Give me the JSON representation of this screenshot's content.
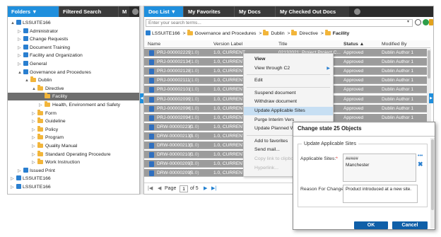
{
  "left_panel": {
    "tabs": [
      {
        "label": "Folders ▼",
        "active": true
      },
      {
        "label": "Filtered Search",
        "active": false
      },
      {
        "label": "M",
        "active": false
      }
    ],
    "tree": [
      {
        "label": "LSSUITE166",
        "icon": "site-icon",
        "toggle": "▲",
        "level": 0
      },
      {
        "label": "Administrator",
        "icon": "site-icon",
        "toggle": "▷",
        "level": 1
      },
      {
        "label": "Change Requests",
        "icon": "site-icon",
        "toggle": "▷",
        "level": 1
      },
      {
        "label": "Document Training",
        "icon": "site-icon",
        "toggle": "▷",
        "level": 1
      },
      {
        "label": "Facility and Organization",
        "icon": "site-icon",
        "toggle": "▷",
        "level": 1
      },
      {
        "label": "General",
        "icon": "site-icon",
        "toggle": "▷",
        "level": 1
      },
      {
        "label": "Governance and Procedures",
        "icon": "site-icon",
        "toggle": "▲",
        "level": 1
      },
      {
        "label": "Dublin",
        "icon": "folder-icon",
        "toggle": "▲",
        "level": 2
      },
      {
        "label": "Directive",
        "icon": "folder-icon",
        "toggle": "▲",
        "level": 3
      },
      {
        "label": "Facility",
        "icon": "folder-icon",
        "toggle": "",
        "level": 4,
        "selected": true
      },
      {
        "label": "Health, Environment and Safety",
        "icon": "folder-icon",
        "toggle": "▷",
        "level": 4
      },
      {
        "label": "Form",
        "icon": "folder-icon",
        "toggle": "▷",
        "level": 3
      },
      {
        "label": "Guideline",
        "icon": "folder-icon",
        "toggle": "▷",
        "level": 3
      },
      {
        "label": "Policy",
        "icon": "folder-icon",
        "toggle": "▷",
        "level": 3
      },
      {
        "label": "Program",
        "icon": "folder-icon",
        "toggle": "▷",
        "level": 3
      },
      {
        "label": "Quality Manual",
        "icon": "folder-icon",
        "toggle": "▷",
        "level": 3
      },
      {
        "label": "Standard Operating Procedure",
        "icon": "folder-icon",
        "toggle": "▷",
        "level": 3
      },
      {
        "label": "Work Instruction",
        "icon": "folder-icon",
        "toggle": "▷",
        "level": 3
      },
      {
        "label": "Issued Print",
        "icon": "site-icon",
        "toggle": "▷",
        "level": 1
      },
      {
        "label": "LSSUITE166",
        "icon": "site-icon",
        "toggle": "▷",
        "level": 0
      },
      {
        "label": "LSSUITE166",
        "icon": "site-icon",
        "toggle": "▷",
        "level": 0
      }
    ]
  },
  "right_panel": {
    "tabs": [
      {
        "label": "Doc List ▼",
        "active": true
      },
      {
        "label": "My Favorites",
        "active": false
      },
      {
        "label": "My Docs",
        "active": false
      },
      {
        "label": "My Checked Out Docs",
        "active": false
      }
    ],
    "search_placeholder": "Enter your search terms...",
    "breadcrumb": [
      "LSSUITE166",
      "Governance and Procedures",
      "Dublin",
      "Directive",
      "Facility"
    ],
    "columns": {
      "name": "Name",
      "version_label": "Version Label",
      "title": "Title",
      "status": "Status ▲",
      "modified_by": "Modified By"
    },
    "rows": [
      {
        "name": "PRJ-000002229",
        "ver": "(1.0)",
        "label": "1.0, CURRENT",
        "title": "02132021: Project Project C...",
        "status": "Approved",
        "modified_by": "Dublin Author 1"
      },
      {
        "name": "PRJ-000002134",
        "ver": "(1.0)",
        "label": "1.0, CURRENT",
        "title": "",
        "status": "Approved",
        "modified_by": "Dublin Author 1"
      },
      {
        "name": "PRJ-000002128",
        "ver": "(1.0)",
        "label": "1.0, CURRENT",
        "title": "",
        "status": "Approved",
        "modified_by": "Dublin Author 1"
      },
      {
        "name": "PRJ-000002111",
        "ver": "(1.0)",
        "label": "1.0, CURRENT",
        "title": "",
        "status": "Approved",
        "modified_by": "Dublin Author 1"
      },
      {
        "name": "PRJ-000002101",
        "ver": "(1.0)",
        "label": "1.0, CURRENT",
        "title": "",
        "status": "Approved",
        "modified_by": "Dublin Author 1"
      },
      {
        "name": "PRJ-000002099",
        "ver": "(1.0)",
        "label": "1.0, CURRENT",
        "title": "",
        "status": "Approved",
        "modified_by": "Dublin Author 1"
      },
      {
        "name": "PRJ-000002096",
        "ver": "(1.0)",
        "label": "1.0, CURRENT",
        "title": "",
        "status": "Approved",
        "modified_by": "Dublin Author 1"
      },
      {
        "name": "PRJ-000002094",
        "ver": "(1.0)",
        "label": "1.0, CURRENT",
        "title": "",
        "status": "Approved",
        "modified_by": "Dublin Author 1"
      },
      {
        "name": "DRW-000002230",
        "ver": "(1.0)",
        "label": "1.0, CURRENT",
        "title": "",
        "status": "",
        "modified_by": ""
      },
      {
        "name": "DRW-000002133",
        "ver": "(1.0)",
        "label": "1.0, CURRENT",
        "title": "",
        "status": "",
        "modified_by": ""
      },
      {
        "name": "DRW-000002131",
        "ver": "(1.0)",
        "label": "1.0, CURRENT",
        "title": "",
        "status": "",
        "modified_by": ""
      },
      {
        "name": "DRW-000002100",
        "ver": "(1.0)",
        "label": "1.0, CURRENT",
        "title": "",
        "status": "",
        "modified_by": ""
      },
      {
        "name": "DRW-000002097",
        "ver": "(1.0)",
        "label": "1.0, CURRENT",
        "title": "",
        "status": "",
        "modified_by": ""
      },
      {
        "name": "DRW-000002095",
        "ver": "(1.0)",
        "label": "1.0, CURRENT",
        "title": "",
        "status": "",
        "modified_by": ""
      }
    ],
    "pager": {
      "page_label": "Page",
      "page_value": "1",
      "of_label": "of 5"
    }
  },
  "context_menu": {
    "items": [
      {
        "label": "View",
        "bold": true
      },
      {
        "label": "View through C2",
        "submenu": true
      },
      {
        "sep": true
      },
      {
        "label": "Edit"
      },
      {
        "sep": true
      },
      {
        "label": "Suspend document"
      },
      {
        "label": "Withdraw document"
      },
      {
        "label": "Update Applicable Sites",
        "highlight": true
      },
      {
        "label": "Purge Interim Vers"
      },
      {
        "label": "Update Planned W"
      },
      {
        "sep": true
      },
      {
        "label": "Add to favorites"
      },
      {
        "label": "Send mail..."
      },
      {
        "label": "Copy link to clipbo",
        "disabled": true
      },
      {
        "label": "Hyperlink...",
        "disabled": true
      }
    ]
  },
  "dialog": {
    "title": "Change state 25 Objects",
    "group_title": "Update Applicable Sites",
    "applicable_sites_label": "Applicable Sites:",
    "applicable_sites": [
      "#####",
      "Manchester"
    ],
    "reason_label": "Reason For Change:",
    "reason_value": "Product introduced at a new site.",
    "ok_label": "OK",
    "cancel_label": "Cancel",
    "required_mark": "*"
  },
  "colors": {
    "accent": "#1f8fdd",
    "row_selected": "#9c9c9c",
    "button": "#0f5fa8"
  }
}
